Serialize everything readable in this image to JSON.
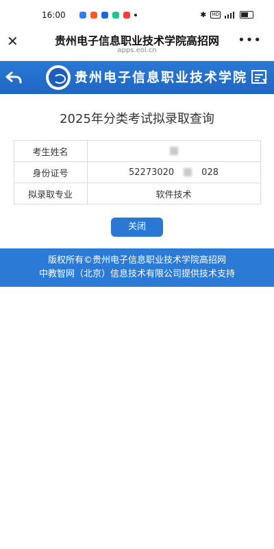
{
  "status_bar": {
    "time": "16:00",
    "app_icons": [
      "#2f7cf6",
      "#ff5a1f",
      "#1e66e0",
      "#1ec68a",
      "#ff3b3b"
    ],
    "hd_label": "HD"
  },
  "browser": {
    "title": "贵州电子信息职业技术学院高招网",
    "url": "apps.eol.cn",
    "close_icon": "close-icon",
    "more_icon": "more-icon"
  },
  "header": {
    "school_name": "贵州电子信息职业技术学院",
    "back_icon": "back-arrow-icon",
    "menu_icon": "menu-icon",
    "accent_color": "#1f66c1"
  },
  "page": {
    "title": "2025年分类考试拟录取查询"
  },
  "table": {
    "rows": [
      {
        "label": "考生姓名",
        "value": ""
      },
      {
        "label": "身份证号",
        "value_prefix": "52273020",
        "value_suffix": "028"
      },
      {
        "label": "拟录取专业",
        "value": "软件技术"
      }
    ]
  },
  "close_button": {
    "label": "关闭"
  },
  "footer": {
    "line1": "版权所有©贵州电子信息职业技术学院高招网",
    "line2": "中教智网（北京）信息技术有限公司提供技术支持"
  }
}
